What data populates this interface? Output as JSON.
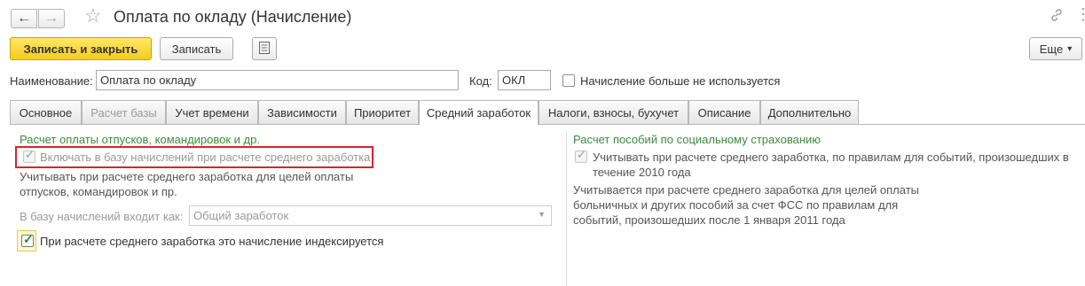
{
  "window": {
    "title": "Оплата по окладу (Начисление)",
    "back_icon": "arrow-left-icon",
    "forward_icon": "arrow-right-icon",
    "favorite_icon": "star-icon",
    "link_icon": "link-icon",
    "menu_icon": "more-vertical-icon"
  },
  "toolbar": {
    "save_close_label": "Записать и закрыть",
    "save_label": "Записать",
    "list_icon": "list-icon",
    "more_label": "Еще",
    "more_arrow": "▾"
  },
  "fields": {
    "name_label": "Наименование:",
    "name_value": "Оплата по окладу",
    "code_label": "Код:",
    "code_value": "ОКЛ",
    "not_used_label": "Начисление больше не используется",
    "not_used_checked": false
  },
  "tabs": [
    {
      "label": "Основное",
      "active": false,
      "disabled": false
    },
    {
      "label": "Расчет базы",
      "active": false,
      "disabled": true
    },
    {
      "label": "Учет времени",
      "active": false,
      "disabled": false
    },
    {
      "label": "Зависимости",
      "active": false,
      "disabled": false
    },
    {
      "label": "Приоритет",
      "active": false,
      "disabled": false
    },
    {
      "label": "Средний заработок",
      "active": true,
      "disabled": false
    },
    {
      "label": "Налоги, взносы, бухучет",
      "active": false,
      "disabled": false
    },
    {
      "label": "Описание",
      "active": false,
      "disabled": false
    },
    {
      "label": "Дополнительно",
      "active": false,
      "disabled": false
    }
  ],
  "left": {
    "section_title": "Расчет оплаты отпусков, командировок и др.",
    "include_base_label": "Включать в базу начислений при расчете среднего заработка",
    "include_base_checked": true,
    "note_line1": "Учитывать при расчете среднего заработка для целей оплаты",
    "note_line2": "отпусков, командировок и пр.",
    "base_label": "В базу начислений входит как:",
    "base_value": "Общий заработок",
    "indexed_label": "При расчете среднего заработка это начисление индексируется",
    "indexed_checked": true
  },
  "right": {
    "section_title": "Расчет пособий по социальному страхованию",
    "fss_label_line1": "Учитывать при расчете среднего заработка, по правилам для событий, произошедших в",
    "fss_label_line2": "течение 2010 года",
    "fss_checked": true,
    "note_line1": "Учитывается при расчете среднего заработка для целей оплаты",
    "note_line2": "больничных и других пособий за счет ФСС по правилам для",
    "note_line3": "событий, произошедших после 1 января 2011 года"
  },
  "colors": {
    "accent_yellow": "#f5cc1d",
    "section_green": "#3c8c3c",
    "highlight_red": "#d9232d",
    "check_green": "#2e8b2e"
  }
}
